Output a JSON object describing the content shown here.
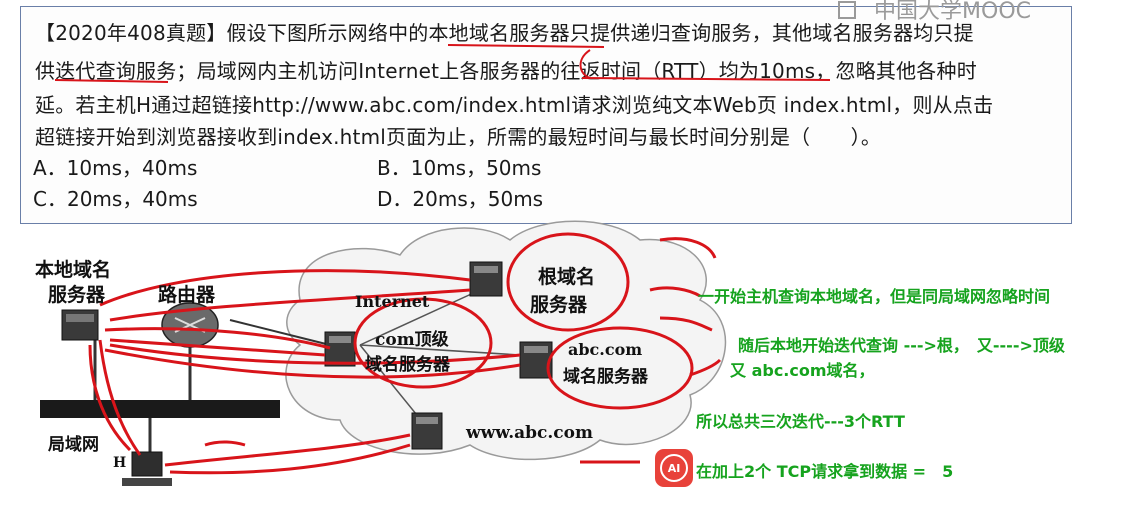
{
  "watermark": "中国大学MOOC",
  "question": {
    "line1": "【2020年408真题】假设下图所示网络中的本地域名服务器只提供递归查询服务，其他域名服务器均只提",
    "line2": "供迭代查询服务；局域网内主机访问Internet上各服务器的往返时间（RTT）均为10ms，忽略其他各种时",
    "line3": "延。若主机H通过超链接http://www.abc.com/index.html请求浏览纯文本Web页 index.html，则从点击",
    "line4": "超链接开始到浏览器接收到index.html页面为止，所需的最短时间与最长时间分别是（　　）。"
  },
  "options": {
    "a": "A．10ms，40ms",
    "b": "B．10ms，50ms",
    "c": "C．20ms，40ms",
    "d": "D．20ms，50ms"
  },
  "diagram": {
    "local_dns_line1": "本地域名",
    "local_dns_line2": "服务器",
    "router": "路由器",
    "internet": "Internet",
    "root_line1": "根域名",
    "root_line2": "服务器",
    "com_line1": "com顶级",
    "com_line2": "域名服务器",
    "abc_line1": "abc.com",
    "abc_line2": "域名服务器",
    "lan": "局域网",
    "host_h": "H",
    "www": "www.abc.com"
  },
  "notes": {
    "n1": "一开始主机查询本地域名，但是同局域网忽略时间",
    "n2": "随后本地开始迭代查询 --->根，　又---->顶级",
    "n3": "又 abc.com域名，",
    "n4": "所以总共三次迭代---3个RTT",
    "n5": "在加上2个 TCP请求拿到数据 =　5"
  },
  "ai_badge": "AI",
  "colors": {
    "annotation_red": "#d8141a",
    "note_green": "#16a31e",
    "frame": "#6a7fa8"
  }
}
